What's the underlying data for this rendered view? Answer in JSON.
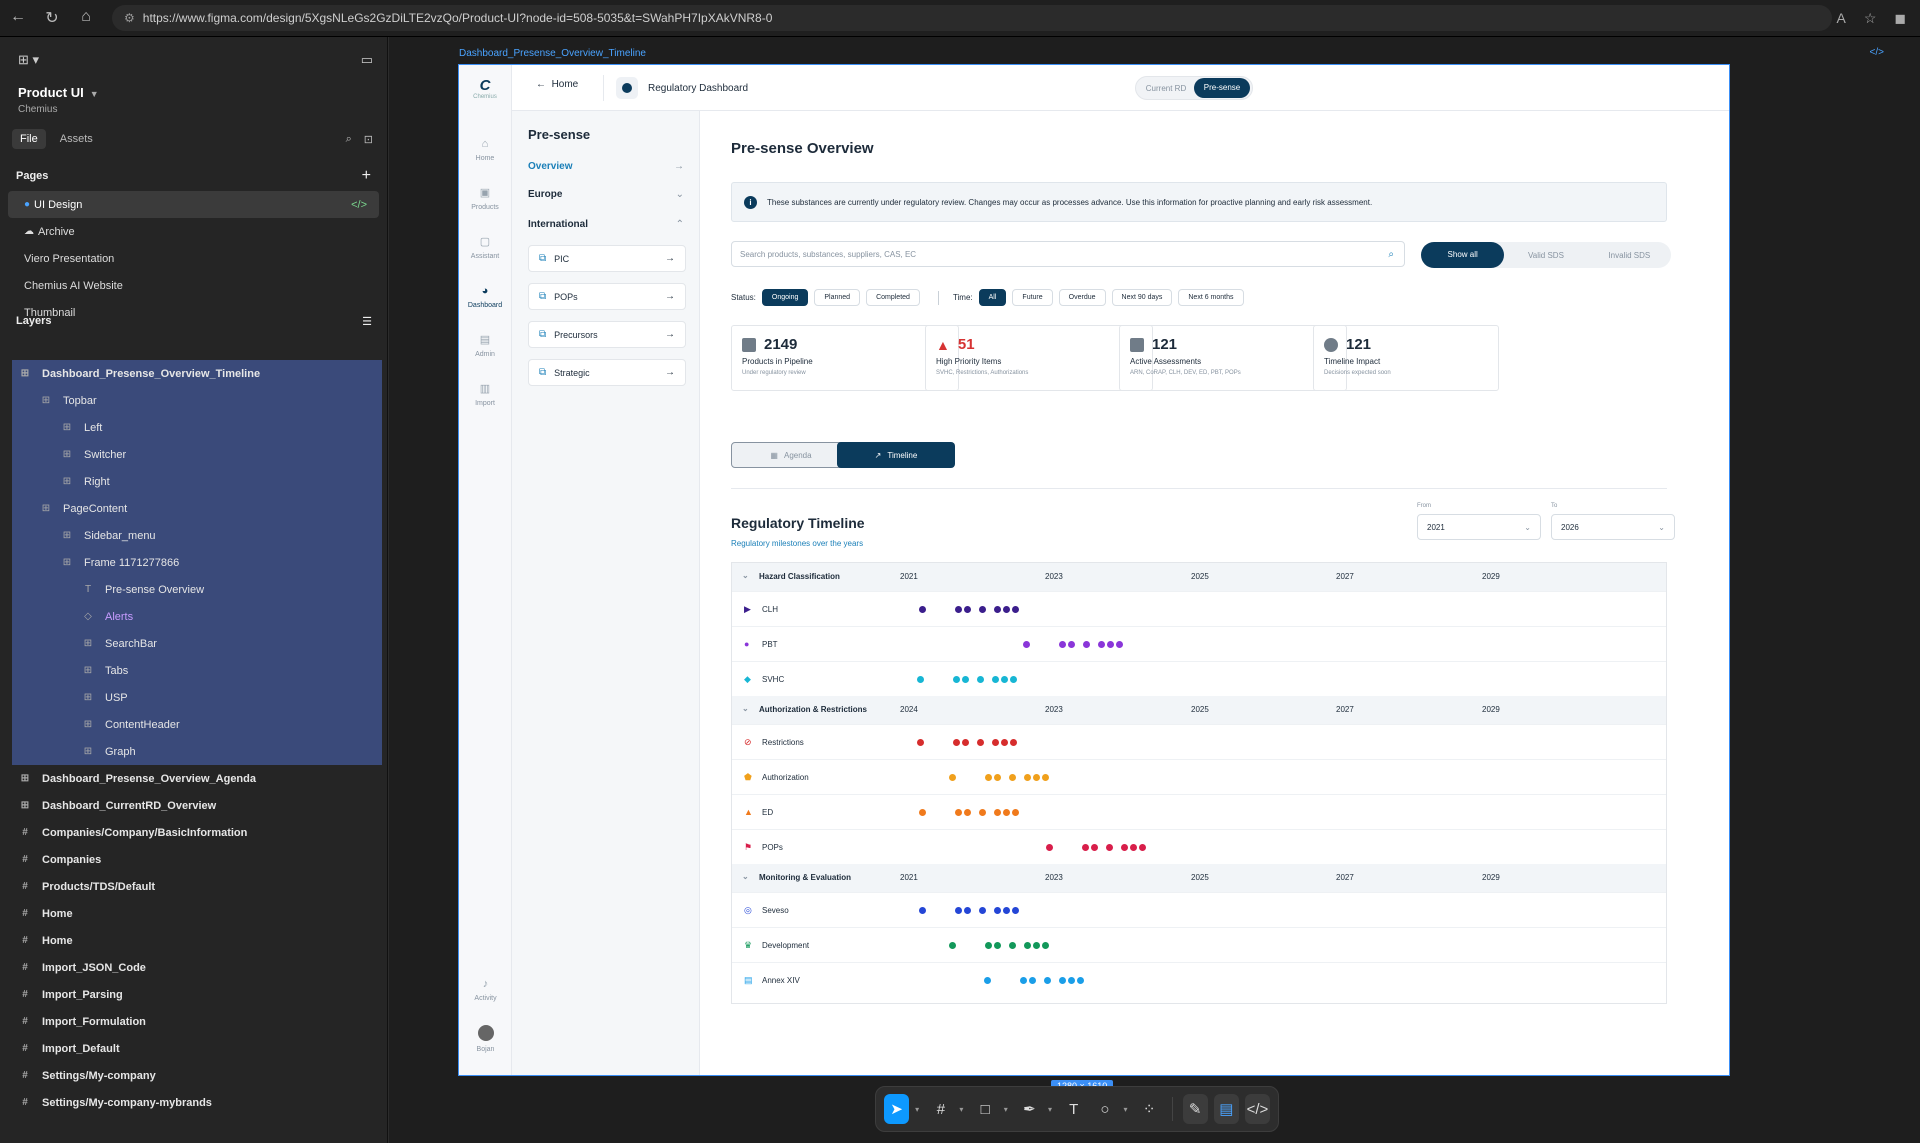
{
  "browser": {
    "url": "https://www.figma.com/design/5XgsNLeGs2GzDiLTE2vzQo/Product-UI?node-id=508-5035&t=SWahPH7IpXAkVNR8-0"
  },
  "figma": {
    "project_name": "Product UI",
    "team": "Chemius",
    "tabs": [
      "File",
      "Assets"
    ],
    "pages_title": "Pages",
    "pages": [
      "UI Design",
      "Archive",
      "Viero Presentation",
      "Chemius AI Website",
      "Thumbnail"
    ],
    "layers_title": "Layers",
    "selected_layers": [
      {
        "name": "Dashboard_Presense_Overview_Timeline",
        "indent": 0
      },
      {
        "name": "Topbar",
        "indent": 1
      },
      {
        "name": "Left",
        "indent": 2
      },
      {
        "name": "Switcher",
        "indent": 2
      },
      {
        "name": "Right",
        "indent": 2
      },
      {
        "name": "PageContent",
        "indent": 1
      },
      {
        "name": "Sidebar_menu",
        "indent": 2
      },
      {
        "name": "Frame 1171277866",
        "indent": 2
      },
      {
        "name": "Pre-sense Overview",
        "indent": 3
      },
      {
        "name": "Alerts",
        "indent": 3
      },
      {
        "name": "SearchBar",
        "indent": 3
      },
      {
        "name": "Tabs",
        "indent": 3
      },
      {
        "name": "USP",
        "indent": 3
      },
      {
        "name": "ContentHeader",
        "indent": 3
      },
      {
        "name": "Graph",
        "indent": 3
      }
    ],
    "other_layers": [
      "Dashboard_Presense_Overview_Agenda",
      "Dashboard_CurrentRD_Overview",
      "Companies/Company/BasicInformation",
      "Companies",
      "Products/TDS/Default",
      "Home",
      "Home",
      "Import_JSON_Code",
      "Import_Parsing",
      "Import_Formulation",
      "Import_Default",
      "Settings/My-company",
      "Settings/My-company-mybrands"
    ],
    "frame_label": "Dashboard_Presense_Overview_Timeline",
    "frame_size": "1280 × 1610"
  },
  "app": {
    "logo_text": "Chemius",
    "rail": [
      "Home",
      "Products",
      "Assistant",
      "Dashboard",
      "Admin",
      "Import"
    ],
    "rail_bottom": [
      "Activity",
      "Bojan"
    ],
    "topbar": {
      "home": "Home",
      "section": "Regulatory Dashboard",
      "switch_options": [
        "Current RD",
        "Pre-sense"
      ]
    },
    "sidemenu": {
      "title": "Pre-sense",
      "overview": "Overview",
      "europe": "Europe",
      "international": "International",
      "cards": [
        "PIC",
        "POPs",
        "Precursors",
        "Strategic"
      ]
    },
    "page_title": "Pre-sense Overview",
    "alert": "These substances are currently under regulatory review. Changes may occur as processes advance. Use this information for proactive planning and early risk assessment.",
    "search_placeholder": "Search products, substances, suppliers, CAS, EC",
    "sds_filter": [
      "Show all",
      "Valid SDS",
      "Invalid SDS"
    ],
    "status_label": "Status:",
    "status_chips": [
      "Ongoing",
      "Planned",
      "Completed"
    ],
    "time_label": "Time:",
    "time_chips": [
      "All",
      "Future",
      "Overdue",
      "Next 90 days",
      "Next 6 months"
    ],
    "kpis": [
      {
        "value": "2149",
        "title": "Products in Pipeline",
        "sub": "Under regulatory review"
      },
      {
        "value": "51",
        "title": "High Priority Items",
        "sub": "SVHC, Restrictions, Authorizations"
      },
      {
        "value": "121",
        "title": "Active Assessments",
        "sub": "ARN, CoRAP, CLH, DEV, ED, PBT, POPs"
      },
      {
        "value": "121",
        "title": "Timeline Impact",
        "sub": "Decisions expected soon"
      }
    ],
    "view_tabs": [
      "Agenda",
      "Timeline"
    ],
    "timeline_title": "Regulatory Timeline",
    "timeline_sub": "Regulatory milestones over the years",
    "from_label": "From",
    "to_label": "To",
    "from_value": "2021",
    "to_value": "2026",
    "groups": [
      {
        "name": "Hazard Classification",
        "years": [
          "2021",
          "2023",
          "2025",
          "2027",
          "2029"
        ],
        "rows": [
          {
            "name": "CLH",
            "color": "#3b1e8c",
            "offset": 0
          },
          {
            "name": "PBT",
            "color": "#8a36d9",
            "offset": 1
          },
          {
            "name": "SVHC",
            "color": "#17b6d4",
            "offset": 2
          }
        ]
      },
      {
        "name": "Authorization & Restrictions",
        "years": [
          "2024",
          "2023",
          "2025",
          "2027",
          "2029"
        ],
        "rows": [
          {
            "name": "Restrictions",
            "color": "#d62d2d",
            "offset": 2
          },
          {
            "name": "Authorization",
            "color": "#f0a01c",
            "offset": 3
          },
          {
            "name": "ED",
            "color": "#f07a1c",
            "offset": 0
          },
          {
            "name": "POPs",
            "color": "#d81e4a",
            "offset": 4
          }
        ]
      },
      {
        "name": "Monitoring & Evaluation",
        "years": [
          "2021",
          "2023",
          "2025",
          "2027",
          "2029"
        ],
        "rows": [
          {
            "name": "Seveso",
            "color": "#2446d6",
            "offset": 0
          },
          {
            "name": "Development",
            "color": "#12985a",
            "offset": 3
          },
          {
            "name": "Annex XIV",
            "color": "#1a9ee8",
            "offset": 5
          }
        ]
      }
    ]
  }
}
